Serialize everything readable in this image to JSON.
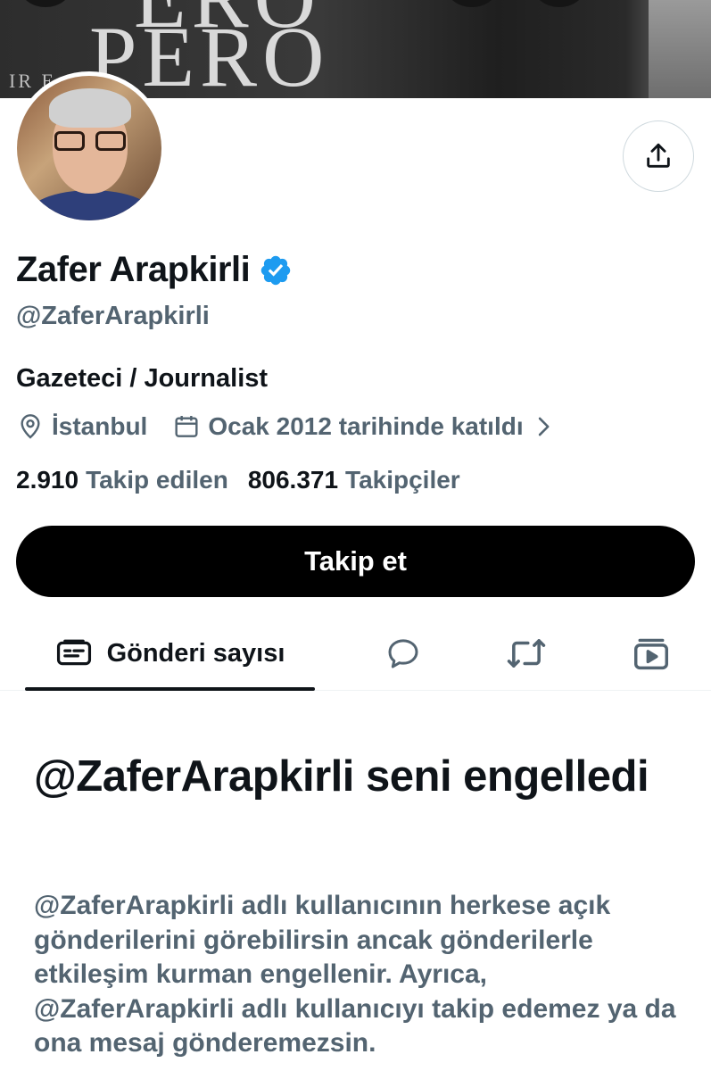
{
  "banner": {
    "text_large": "PERO",
    "text_top": "ERO",
    "text_small": "IR E"
  },
  "profile": {
    "name": "Zafer Arapkirli",
    "handle": "@ZaferArapkirli",
    "bio": "Gazeteci / Journalist",
    "location": "İstanbul",
    "joined": "Ocak 2012 tarihinde katıldı",
    "following_count": "2.910",
    "following_label": "Takip edilen",
    "followers_count": "806.371",
    "followers_label": "Takipçiler",
    "verified_color": "#1d9bf0"
  },
  "actions": {
    "follow_label": "Takip et",
    "share_icon": "share-icon"
  },
  "tabs": [
    {
      "label": "Gönderi sayısı",
      "icon": "posts-icon",
      "active": true
    },
    {
      "label": "",
      "icon": "replies-icon",
      "active": false
    },
    {
      "label": "",
      "icon": "reposts-icon",
      "active": false
    },
    {
      "label": "",
      "icon": "media-icon",
      "active": false
    }
  ],
  "blocked": {
    "title": "@ZaferArapkirli seni engelledi",
    "description": "@ZaferArapkirli adlı kullanıcının herkese açık gönderilerini görebilirsin ancak gönderilerle etkileşim kurman engellenir. Ayrıca, @ZaferArapkirli adlı kullanıcıyı takip edemez ya da ona mesaj gönderemezsin."
  }
}
